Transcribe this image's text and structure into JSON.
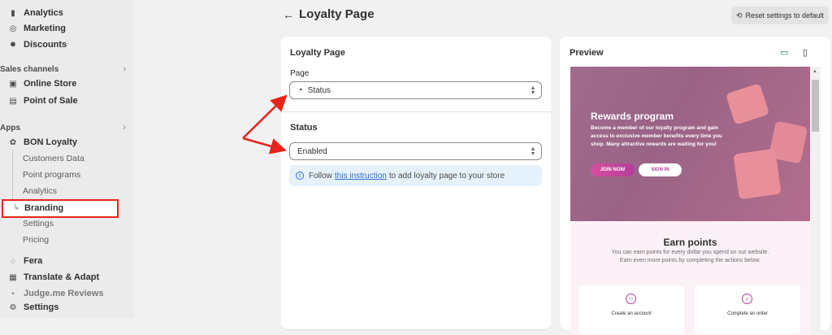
{
  "sidebar": {
    "top_items": [
      {
        "label": "Analytics",
        "icon": "bar-chart-icon"
      },
      {
        "label": "Marketing",
        "icon": "target-icon"
      },
      {
        "label": "Discounts",
        "icon": "discount-icon"
      }
    ],
    "sales_channels": {
      "heading": "Sales channels",
      "items": [
        {
          "label": "Online Store",
          "icon": "store-icon"
        },
        {
          "label": "Point of Sale",
          "icon": "pos-icon"
        }
      ]
    },
    "apps": {
      "heading": "Apps",
      "app_name": "BON Loyalty",
      "sub_items": [
        "Customers Data",
        "Point programs",
        "Analytics",
        "Branding",
        "Settings",
        "Pricing"
      ],
      "other_apps": [
        "Fera",
        "Translate & Adapt",
        "Judge.me Reviews"
      ]
    },
    "settings_label": "Settings"
  },
  "header": {
    "title": "Loyalty Page",
    "reset_label": "Reset settings to default"
  },
  "settings_card": {
    "title": "Loyalty Page",
    "page_label": "Page",
    "page_value": "Status",
    "status_title": "Status",
    "status_value": "Enabled",
    "info_prefix": "Follow",
    "info_link": "this instruction",
    "info_suffix": "to add loyalty page to your store"
  },
  "preview": {
    "title": "Preview",
    "hero_title": "Rewards program",
    "hero_desc": "Become a member of our loyalty program and gain access to exclusive member benefits every time you shop. Many attractive rewards are waiting for you!",
    "join_label": "JOIN NOW",
    "sign_label": "SIGN IN",
    "earn_title": "Earn points",
    "earn_desc": "You can earn points for every dollar you spend on our website. Earn even more points by completing the actions below.",
    "earn_cards": [
      "Create an account",
      "Complete an order"
    ]
  },
  "colors": {
    "highlight": "#e8231b",
    "link": "#2c6ecb",
    "hero_bg": "#a06b8d",
    "accent": "#b23d9a"
  }
}
